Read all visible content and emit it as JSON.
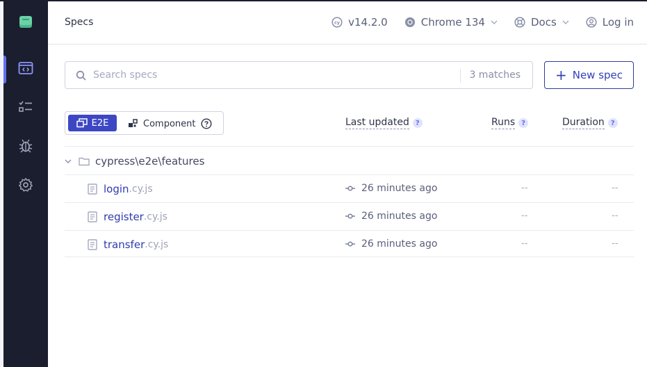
{
  "sidebar": {
    "logo": "cypress-logo-icon",
    "items": [
      {
        "icon": "specs-icon",
        "active": true
      },
      {
        "icon": "runs-icon",
        "active": false
      },
      {
        "icon": "debug-icon",
        "active": false
      },
      {
        "icon": "settings-icon",
        "active": false
      }
    ]
  },
  "header": {
    "title": "Specs",
    "version": "v14.2.0",
    "browser": "Chrome 134",
    "docs": "Docs",
    "login": "Log in"
  },
  "search": {
    "placeholder": "Search specs",
    "value": "",
    "matches": "3 matches"
  },
  "new_spec_label": "New spec",
  "testing_type": {
    "e2e_label": "E2E",
    "component_label": "Component",
    "selected": "E2E"
  },
  "columns": {
    "last_updated": "Last updated",
    "runs": "Runs",
    "duration": "Duration",
    "help": "?"
  },
  "directory": "cypress\\e2e\\features",
  "specs": [
    {
      "name": "login",
      "ext": ".cy.js",
      "updated": "26 minutes ago",
      "runs": "--",
      "duration": "--"
    },
    {
      "name": "register",
      "ext": ".cy.js",
      "updated": "26 minutes ago",
      "runs": "--",
      "duration": "--"
    },
    {
      "name": "transfer",
      "ext": ".cy.js",
      "updated": "26 minutes ago",
      "runs": "--",
      "duration": "--"
    }
  ],
  "colors": {
    "sidebar_bg": "#1b1e2e",
    "accent": "#3d47c4",
    "link": "#2e3bb0",
    "logo": "#69d3a7"
  }
}
